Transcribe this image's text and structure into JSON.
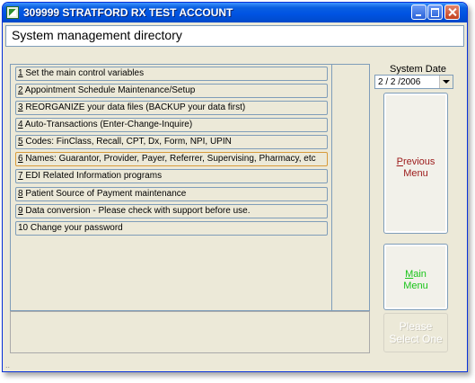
{
  "window": {
    "title": "309999 STRATFORD RX TEST ACCOUNT"
  },
  "header": {
    "title": "System management directory"
  },
  "menu": {
    "items": [
      {
        "key": "1",
        "rest": " Set the main control variables"
      },
      {
        "key": "2",
        "rest": " Appointment Schedule Maintenance/Setup"
      },
      {
        "key": "3",
        "rest": " REORGANIZE your data files (BACKUP your data first)"
      },
      {
        "key": "4",
        "rest": " Auto-Transactions (Enter-Change-Inquire)"
      },
      {
        "key": "5",
        "rest": " Codes: FinClass, Recall, CPT, Dx, Form, NPI, UPIN"
      },
      {
        "key": "6",
        "rest": " Names: Guarantor, Provider, Payer, Referrer, Supervising, Pharmacy, etc"
      },
      {
        "key": "7",
        "rest": " EDI Related Information programs"
      },
      {
        "key": "8",
        "rest": " Patient Source of Payment maintenance"
      },
      {
        "key": "9",
        "rest": " Data conversion - Please check with support before use."
      },
      {
        "key": "",
        "rest": "10 Change your password"
      }
    ],
    "selected_index": 5
  },
  "system_date": {
    "label": "System Date",
    "value": "2 / 2 /2006"
  },
  "buttons": {
    "previous": {
      "hotkey": "P",
      "line1_rest": "revious",
      "line2": "Menu"
    },
    "main": {
      "hotkey": "M",
      "line1_rest": "ain",
      "line2": "Menu"
    },
    "please": {
      "line1": "Please",
      "line2": "Select One"
    }
  },
  "status": {
    "grip": ".."
  },
  "colors": {
    "titlebar": "#0054e3",
    "previous_text": "#9c1a1a",
    "main_text": "#19c419",
    "selected_border": "#d89a3a"
  }
}
